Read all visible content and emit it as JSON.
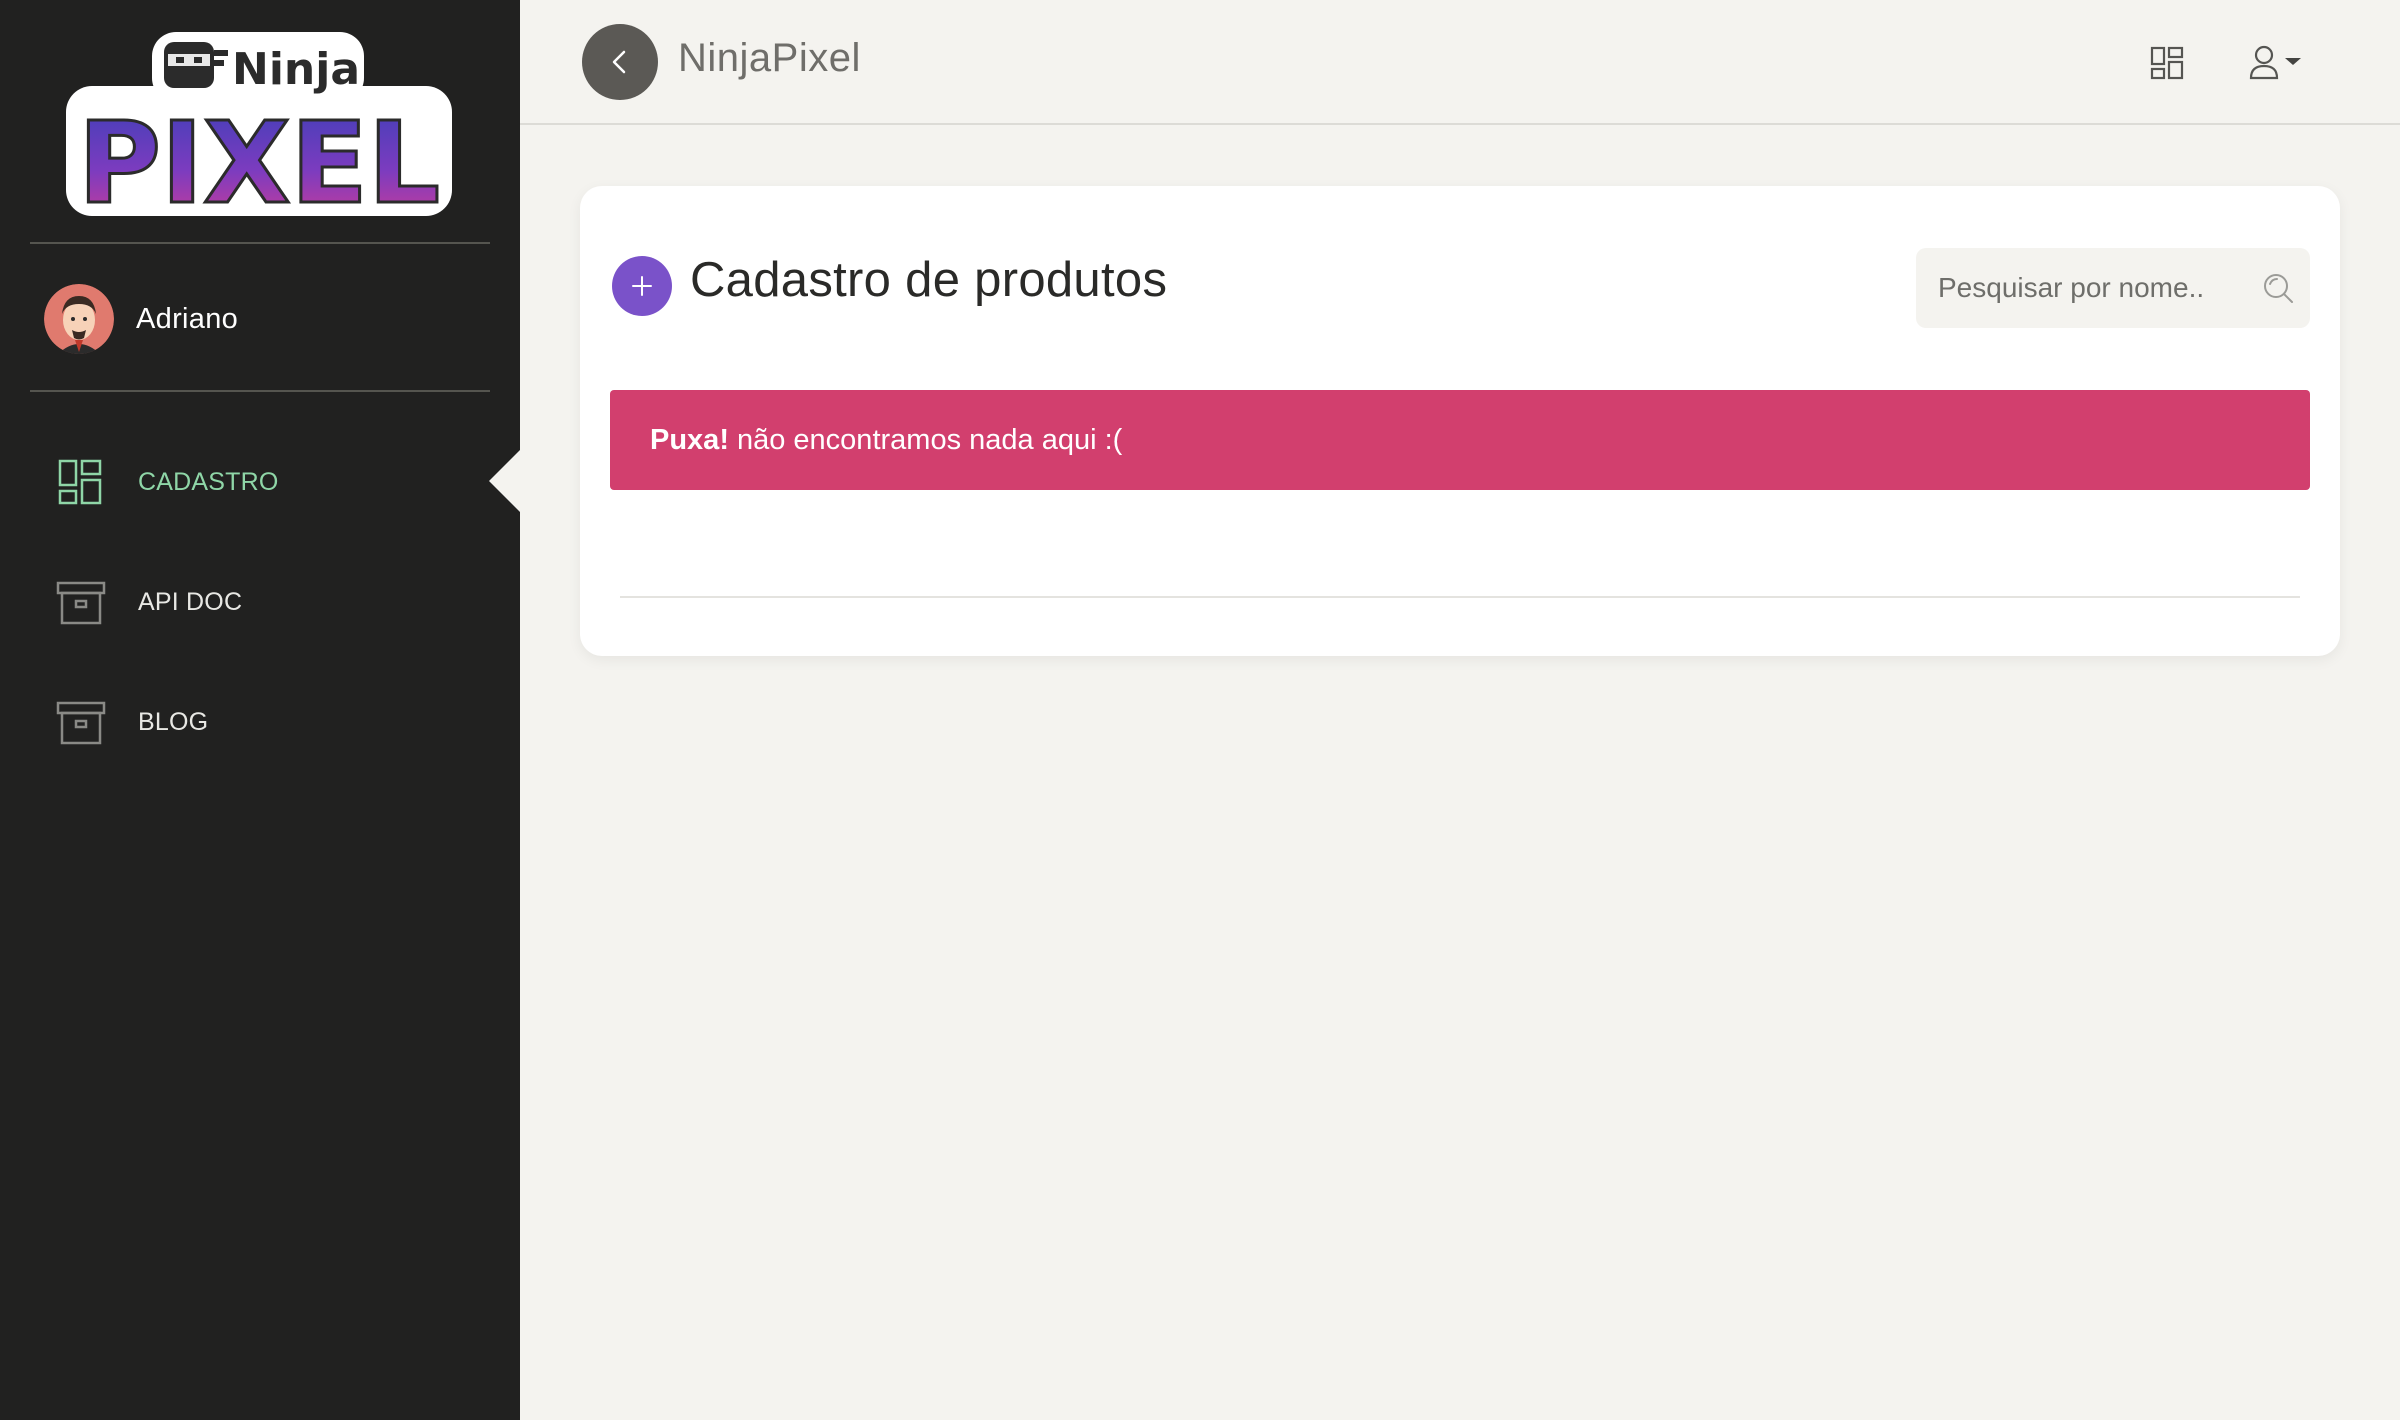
{
  "sidebar": {
    "logo": {
      "line1": "Ninja",
      "line2": "PIXEL"
    },
    "user": {
      "name": "Adriano"
    },
    "items": [
      {
        "label": "CADASTRO",
        "icon": "dashboard-grid-icon",
        "active": true
      },
      {
        "label": "API DOC",
        "icon": "archive-box-icon",
        "active": false
      },
      {
        "label": "BLOG",
        "icon": "archive-box-icon",
        "active": false
      }
    ]
  },
  "header": {
    "title": "NinjaPixel",
    "back_icon": "chevron-left-icon",
    "grid_icon": "dashboard-grid-icon",
    "user_icon": "user-icon"
  },
  "main": {
    "title": "Cadastro de produtos",
    "add_icon": "plus-icon",
    "search": {
      "placeholder": "Pesquisar por nome..",
      "value": ""
    },
    "alert": {
      "strong": "Puxa!",
      "message": "não encontramos nada aqui :("
    }
  },
  "colors": {
    "sidebar_bg": "#212120",
    "page_bg": "#f4f3ef",
    "accent_purple": "#7a52c9",
    "alert_pink": "#d23f6e",
    "active_green": "#8fd6a7"
  }
}
